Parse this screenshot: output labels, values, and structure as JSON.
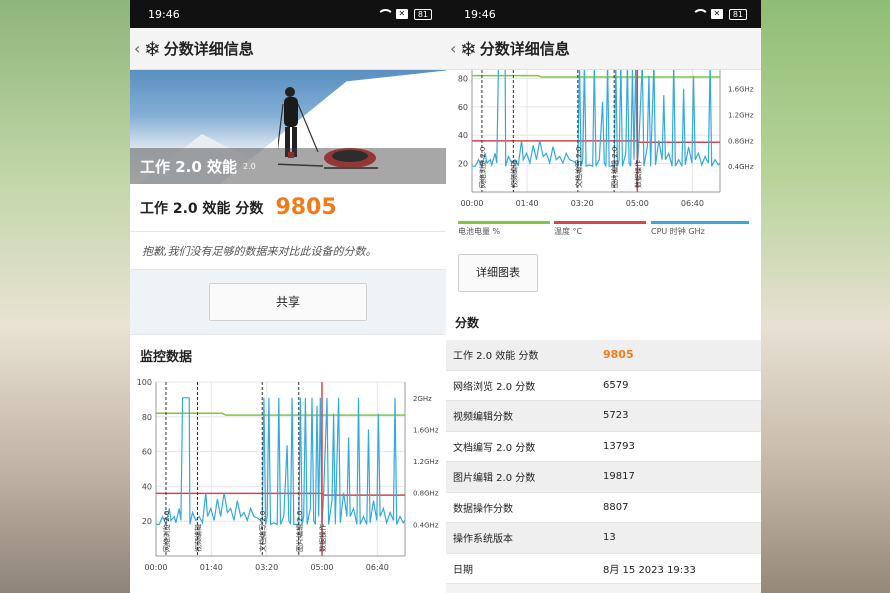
{
  "status": {
    "time": "19:46",
    "battery": "81"
  },
  "header": {
    "back": "‹",
    "title": "分数详细信息"
  },
  "hero": {
    "title": "工作 2.0 效能",
    "version": "2.0"
  },
  "score": {
    "label": "工作 2.0 效能 分数",
    "value": "9805"
  },
  "message": "抱歉,我们没有足够的数据来对比此设备的分数。",
  "share_label": "共享",
  "monitor_title": "监控数据",
  "detail_chart_label": "详细图表",
  "scores_title": "分数",
  "colors": {
    "accent": "#f07b1a",
    "battery": "#7ac943",
    "temp": "#d9434a",
    "cpu": "#33a9dc"
  },
  "legend": [
    {
      "label": "电池电量 %",
      "color": "#7ac943"
    },
    {
      "label": "温度 °C",
      "color": "#d9434a"
    },
    {
      "label": "CPU 时钟 GHz",
      "color": "#33a9dc"
    }
  ],
  "score_rows": [
    {
      "name": "工作 2.0 效能 分数",
      "value": "9805"
    },
    {
      "name": "网络浏览 2.0 分数",
      "value": "6579"
    },
    {
      "name": "视频编辑分数",
      "value": "5723"
    },
    {
      "name": "文档编写 2.0 分数",
      "value": "13793"
    },
    {
      "name": "图片编辑 2.0 分数",
      "value": "19817"
    },
    {
      "name": "数据操作分数",
      "value": "8807"
    },
    {
      "name": "操作系统版本",
      "value": "13"
    },
    {
      "name": "日期",
      "value": "8月 15 2023 19:33"
    }
  ],
  "chart_data": {
    "type": "line",
    "x_ticks": [
      "00:00",
      "01:40",
      "03:20",
      "05:00",
      "06:40"
    ],
    "y_left_ticks": [
      "20",
      "40",
      "60",
      "80",
      "100"
    ],
    "y_left_range": [
      0,
      100
    ],
    "y_right_ticks": [
      "0.4GHz",
      "0.8GHz",
      "1.2GHz",
      "1.6GHz",
      "2GHz"
    ],
    "y_right_range": [
      0,
      2.2
    ],
    "x_range_minutes": [
      0,
      7.5
    ],
    "phase_markers": [
      {
        "label": "网络浏览 2.0",
        "time": 0.3
      },
      {
        "label": "视频编辑",
        "time": 1.25
      },
      {
        "label": "文档编写 2.0",
        "time": 3.2
      },
      {
        "label": "图片编辑 2.0",
        "time": 4.3
      },
      {
        "label": "数据操作",
        "time": 5.0
      }
    ],
    "series": [
      {
        "name": "电池电量 %",
        "axis": "left",
        "points": [
          [
            0,
            82
          ],
          [
            2.0,
            82
          ],
          [
            2.1,
            81
          ],
          [
            7.5,
            81
          ]
        ]
      },
      {
        "name": "温度 °C",
        "axis": "left",
        "points": [
          [
            0,
            36
          ],
          [
            5.0,
            36
          ],
          [
            5.05,
            35
          ],
          [
            7.5,
            35
          ]
        ]
      },
      {
        "name": "CPU 时钟 GHz",
        "axis": "right",
        "points": [
          [
            0,
            0.4
          ],
          [
            0.1,
            0.4
          ],
          [
            0.2,
            0.5
          ],
          [
            0.3,
            0.4
          ],
          [
            0.4,
            0.6
          ],
          [
            0.45,
            0.45
          ],
          [
            0.55,
            0.5
          ],
          [
            0.6,
            0.42
          ],
          [
            0.7,
            0.6
          ],
          [
            0.75,
            0.45
          ],
          [
            0.8,
            2.0
          ],
          [
            1.0,
            2.0
          ],
          [
            1.02,
            0.4
          ],
          [
            1.1,
            0.55
          ],
          [
            1.2,
            0.45
          ],
          [
            1.3,
            0.5
          ],
          [
            1.4,
            0.42
          ],
          [
            1.5,
            0.8
          ],
          [
            1.55,
            0.5
          ],
          [
            1.65,
            0.6
          ],
          [
            1.75,
            0.45
          ],
          [
            1.85,
            0.72
          ],
          [
            1.95,
            0.5
          ],
          [
            2.05,
            0.8
          ],
          [
            2.15,
            0.55
          ],
          [
            2.25,
            0.6
          ],
          [
            2.35,
            0.45
          ],
          [
            2.45,
            0.7
          ],
          [
            2.55,
            0.5
          ],
          [
            2.65,
            0.55
          ],
          [
            2.75,
            0.45
          ],
          [
            2.85,
            0.6
          ],
          [
            2.95,
            0.5
          ],
          [
            3.05,
            0.48
          ],
          [
            3.15,
            0.45
          ],
          [
            3.2,
            0.4
          ],
          [
            3.25,
            2.0
          ],
          [
            3.3,
            0.4
          ],
          [
            3.35,
            0.5
          ],
          [
            3.4,
            2.0
          ],
          [
            3.45,
            0.4
          ],
          [
            3.55,
            0.42
          ],
          [
            3.65,
            0.4
          ],
          [
            3.7,
            2.0
          ],
          [
            3.75,
            0.4
          ],
          [
            3.85,
            0.5
          ],
          [
            3.95,
            1.4
          ],
          [
            4.0,
            0.45
          ],
          [
            4.05,
            0.4
          ],
          [
            4.1,
            2.0
          ],
          [
            4.15,
            0.4
          ],
          [
            4.3,
            0.4
          ],
          [
            4.35,
            2.0
          ],
          [
            4.4,
            0.4
          ],
          [
            4.45,
            0.5
          ],
          [
            4.5,
            2.0
          ],
          [
            4.55,
            0.4
          ],
          [
            4.65,
            0.6
          ],
          [
            4.7,
            2.0
          ],
          [
            4.75,
            0.45
          ],
          [
            4.8,
            0.4
          ],
          [
            4.85,
            1.9
          ],
          [
            4.9,
            0.5
          ],
          [
            4.95,
            2.0
          ],
          [
            5.0,
            0.4
          ],
          [
            5.05,
            0.8
          ],
          [
            5.15,
            2.0
          ],
          [
            5.2,
            0.4
          ],
          [
            5.3,
            0.7
          ],
          [
            5.35,
            1.8
          ],
          [
            5.4,
            0.4
          ],
          [
            5.5,
            2.0
          ],
          [
            5.55,
            0.42
          ],
          [
            5.65,
            0.8
          ],
          [
            5.75,
            0.5
          ],
          [
            5.8,
            1.5
          ],
          [
            5.85,
            0.5
          ],
          [
            5.95,
            0.6
          ],
          [
            6.05,
            0.4
          ],
          [
            6.1,
            2.0
          ],
          [
            6.15,
            0.4
          ],
          [
            6.25,
            0.5
          ],
          [
            6.35,
            0.4
          ],
          [
            6.4,
            1.6
          ],
          [
            6.45,
            0.42
          ],
          [
            6.55,
            0.7
          ],
          [
            6.65,
            0.45
          ],
          [
            6.7,
            1.8
          ],
          [
            6.75,
            0.5
          ],
          [
            6.85,
            0.6
          ],
          [
            6.95,
            0.42
          ],
          [
            7.05,
            0.55
          ],
          [
            7.15,
            0.45
          ],
          [
            7.2,
            2.0
          ],
          [
            7.25,
            0.4
          ],
          [
            7.35,
            0.5
          ],
          [
            7.45,
            0.42
          ],
          [
            7.5,
            0.45
          ]
        ]
      }
    ]
  }
}
